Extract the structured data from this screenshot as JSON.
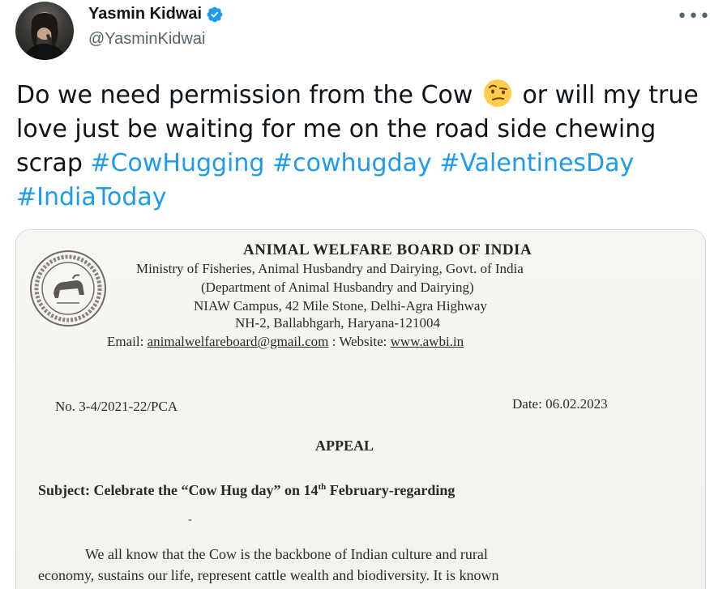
{
  "tweet": {
    "author_name": "Yasmin Kidwai",
    "author_handle": "@YasminKidwai",
    "more_label": "•••",
    "text_before_emoji": "Do we need permission from the Cow",
    "emoji_icon": "face-with-raised-eyebrow-icon",
    "text_after_emoji": " or will my true love just be waiting for me on the road side chewing scrap ",
    "hashtags": [
      "#CowHugging",
      "#cowhugday",
      "#ValentinesDay",
      "#IndiaToday"
    ],
    "link_color": "#1d9bf0",
    "verified_color": "#1d9bf0"
  },
  "document": {
    "org_title": "ANIMAL WELFARE BOARD OF INDIA",
    "ministry_line": "Ministry of Fisheries, Animal Husbandry and Dairying, Govt. of India",
    "department_line": "(Department of Animal Husbandry and Dairying)",
    "campus_line": "NIAW Campus, 42 Mile Stone, Delhi-Agra Highway",
    "address_line": "NH-2, Ballabhgarh, Haryana-121004",
    "email_label": "Email:",
    "email_value": "animalwelfareboard@gmail.com",
    "website_label": ": Website:",
    "website_value": "www.awbi.in",
    "ref_number": "No. 3-4/2021-22/PCA",
    "date": "Date: 06.02.2023",
    "heading": "APPEAL",
    "subject_before": "Subject: Celebrate the “Cow Hug day” on 14",
    "subject_sup": "th",
    "subject_after": " February-regarding",
    "dash": "-",
    "body_line_1": "We all know that the Cow is the backbone of Indian culture and rural",
    "body_line_2": "economy, sustains our life, represent cattle wealth and biodiversity. It is known"
  }
}
